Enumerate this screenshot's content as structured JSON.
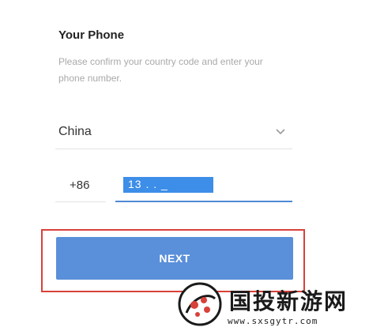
{
  "header": {
    "title": "Your Phone",
    "subtitle": "Please confirm your country code and enter your phone number."
  },
  "country": {
    "selected": "China",
    "icon": "chevron-down-icon"
  },
  "phone": {
    "country_code": "+86",
    "number_visible": "13 . . _"
  },
  "actions": {
    "next_label": "NEXT"
  },
  "watermark": {
    "text": "国投新游网",
    "url": "www.sxsgytr.com"
  },
  "colors": {
    "accent": "#4f88d4",
    "button": "#5a8fd9",
    "highlight": "#d8413a",
    "selection": "#3d8ee8"
  }
}
